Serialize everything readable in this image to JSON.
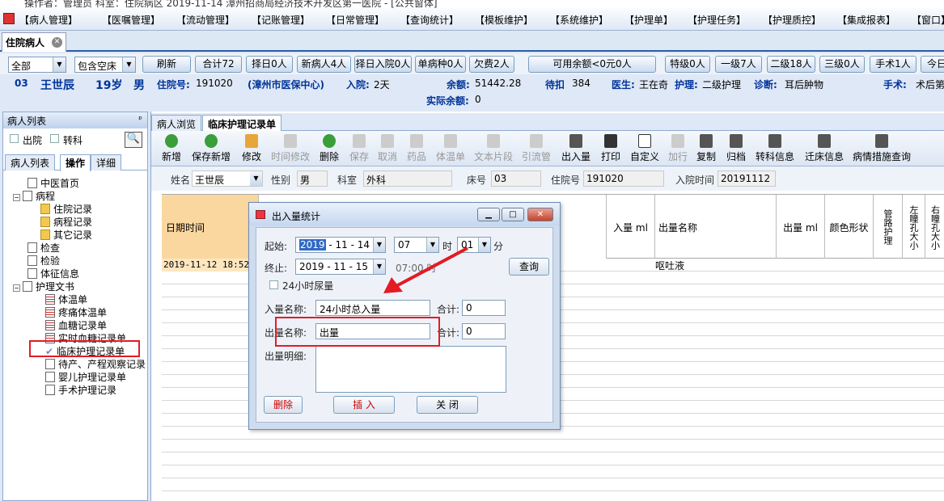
{
  "window_title": "操作者：管理员  科室：住院病区  2019-11-14  漳州招商局经济技术开发区第一医院 - [公共窗体]",
  "menu": [
    "【病人管理】",
    "【医嘱管理】",
    "【流动管理】",
    "【记账管理】",
    "【日常管理】",
    "【查询统计】",
    "【模板维护】",
    "【系统维护】",
    "【护理单】",
    "【护理任务】",
    "【护理质控】",
    "【集成报表】",
    "【窗口】"
  ],
  "doc_tab": "住院病人",
  "filter": {
    "scope": "全部",
    "bed_filter": "包含空床",
    "buttons": [
      "刷新",
      "合计72",
      "择日0人",
      "新病人4人",
      "择日入院0人",
      "单病种0人",
      "欠费2人",
      "可用余额<0元0人",
      "特级0人",
      "一级7人",
      "二级18人",
      "三级0人",
      "手术1人",
      "今日"
    ]
  },
  "patient_bar": {
    "bed": "03",
    "name": "王世辰",
    "age": "19岁",
    "sex": "男",
    "inpatient_no_label": "住院号:",
    "inpatient_no": "191020",
    "insurance": "(漳州市医保中心)",
    "admit_label": "入院:",
    "admit_days": "2天",
    "balance_label": "余额:",
    "balance": "51442.28",
    "withhold_label": "待扣",
    "withhold": "384",
    "doctor_label": "医生:",
    "doctor": "王在奇",
    "nursing_label": "护理:",
    "nursing": "二级护理",
    "diagnosis_label": "诊断:",
    "diagnosis": "耳后肿物",
    "surgery_label": "手术:",
    "surgery": "术后第",
    "actual_label": "实际余额:",
    "actual": "0"
  },
  "left_panel": {
    "title": "病人列表",
    "check_discharged": "出院",
    "check_transfer": "转科",
    "tabs": [
      "病人列表",
      "操作",
      "详细"
    ],
    "tree": [
      "中医首页",
      "病程",
      "住院记录",
      "病程记录",
      "其它记录",
      "检查",
      "检验",
      "体征信息",
      "护理文书",
      "体温单",
      "疼痛体温单",
      "血糖记录单",
      "实时血糖记录单",
      "临床护理记录单",
      "待产、产程观察记录",
      "婴儿护理记录单",
      "手术护理记录"
    ]
  },
  "right_tabs": [
    "病人浏览",
    "临床护理记录单"
  ],
  "toolbar": [
    "新增",
    "保存新增",
    "修改",
    "时间修改",
    "删除",
    "保存",
    "取消",
    "药品",
    "体温单",
    "文本片段",
    "引流管",
    "出入量",
    "打印",
    "自定义",
    "加行",
    "复制",
    "归档",
    "转科信息",
    "迁床信息",
    "病情措施查询"
  ],
  "patient_row": {
    "name_label": "姓名",
    "name": "王世辰",
    "sex_label": "性别",
    "sex": "男",
    "dept_label": "科室",
    "dept": "外科",
    "bed_label": "床号",
    "bed": "03",
    "inpatient_no_label": "住院号",
    "inpatient_no": "191020",
    "admit_time_label": "入院时间",
    "admit_time": "20191112"
  },
  "grid": {
    "headers": [
      "日期时间",
      "入量 ml",
      "出量名称",
      "出量 ml",
      "颜色形状",
      "管路护理",
      "左瞳孔大小",
      "右瞳孔大小"
    ],
    "row_datetime": "2019-11-12 18:52",
    "row_output_name": "呕吐液"
  },
  "dialog": {
    "title": "出入量统计",
    "start_label": "起始:",
    "start_year": "2019",
    "start_rest": "- 11 - 14",
    "start_hour": "07",
    "hour_label": "时",
    "start_min": "01",
    "min_label": "分",
    "end_label": "终止:",
    "end_date": "2019 - 11 - 15",
    "end_time": "07:00 时",
    "query_button": "查询",
    "checkbox_24h": "24小时尿量",
    "intake_label": "入量名称:",
    "intake_value": "24小时总入量",
    "intake_total_label": "合计:",
    "intake_total": "0",
    "output_label": "出量名称:",
    "output_value": "出量",
    "output_total_label": "合计:",
    "output_total": "0",
    "detail_label": "出量明细:",
    "delete_button": "删除",
    "insert_button": "插 入",
    "close_button": "关 闭"
  },
  "colors": {
    "highlight": "#e31b23",
    "accent": "#2b5ea8"
  }
}
